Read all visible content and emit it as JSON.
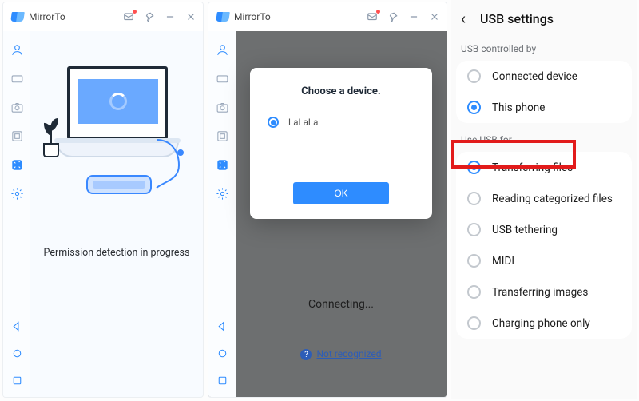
{
  "app": {
    "title": "MirrorTo"
  },
  "panel1": {
    "caption": "Permission detection in progress"
  },
  "panel2": {
    "modal_title": "Choose a device.",
    "device_option": "LaLaLa",
    "ok_label": "OK",
    "connecting_text": "Connecting...",
    "not_recognized_label": "Not recognized"
  },
  "panel3": {
    "header": "USB settings",
    "section1_label": "USB controlled by",
    "section1_options": [
      "Connected device",
      "This phone"
    ],
    "section1_selected": 1,
    "section2_label": "Use USB for",
    "section2_options": [
      "Transferring files",
      "Reading categorized files",
      "USB tethering",
      "MIDI",
      "Transferring images",
      "Charging phone only"
    ],
    "section2_selected": 0,
    "highlighted_option": "Transferring files"
  },
  "colors": {
    "accent": "#2e8cff",
    "highlight_border": "#e21b1b"
  }
}
